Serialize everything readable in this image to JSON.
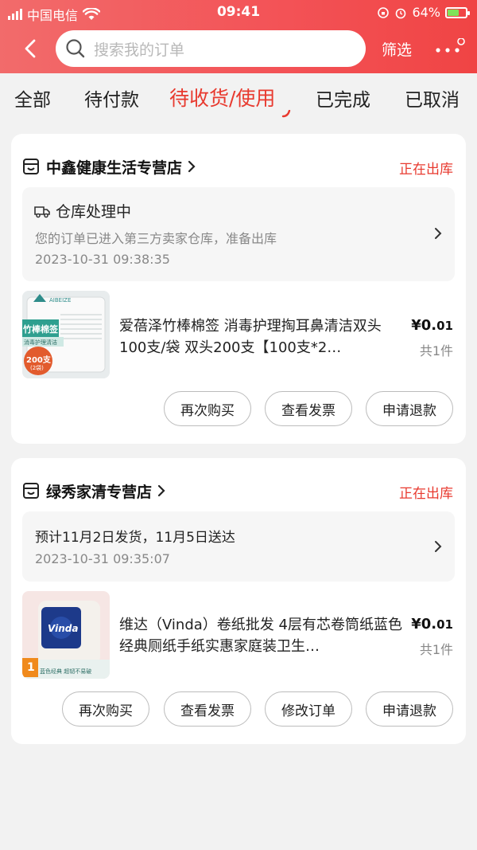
{
  "status_bar": {
    "carrier": "中国电信",
    "time": "09:41",
    "battery": "64%",
    "battery_level": 0.64
  },
  "header": {
    "search_placeholder": "搜索我的订单",
    "filter_label": "筛选"
  },
  "tabs": [
    {
      "label": "全部",
      "active": false
    },
    {
      "label": "待付款",
      "active": false
    },
    {
      "label": "待收货/使用",
      "active": true
    },
    {
      "label": "已完成",
      "active": false
    },
    {
      "label": "已取消",
      "active": false
    }
  ],
  "orders": [
    {
      "store": "中鑫健康生活专营店",
      "status": "正在出库",
      "info": {
        "title": "仓库处理中",
        "desc": "您的订单已进入第三方卖家仓库，准备出库",
        "time": "2023-10-31 09:38:35"
      },
      "product": {
        "title": "爱蓓泽竹棒棉签 消毒护理掏耳鼻清洁双头100支/袋 双头200支【100支*2…",
        "price_main": "¥0.",
        "price_dec": "01",
        "qty": "共1件",
        "thumb_brand": "AIBEIZE",
        "thumb_name": "竹棒棉签",
        "thumb_sub": "消毒护理清洁",
        "thumb_badge_main": "200支",
        "thumb_badge_sub": "(2袋)"
      },
      "buttons": [
        "再次购买",
        "查看发票",
        "申请退款"
      ]
    },
    {
      "store": "绿秀家清专营店",
      "status": "正在出库",
      "info": {
        "title": "预计11月2日发货，11月5日送达",
        "time": "2023-10-31 09:35:07"
      },
      "product": {
        "title": "维达（Vinda）卷纸批发 4层有芯卷筒纸蓝色经典厕纸手纸实惠家庭装卫生…",
        "price_main": "¥0.",
        "price_dec": "01",
        "qty": "共1件",
        "thumb_brand": "Vinda",
        "thumb_badge_main": "1",
        "thumb_sub": "蓝色经典 超韧不易破"
      },
      "buttons": [
        "再次购买",
        "查看发票",
        "修改订单",
        "申请退款"
      ]
    }
  ],
  "colors": {
    "accent": "#e83a2f",
    "header": "#f35256"
  }
}
